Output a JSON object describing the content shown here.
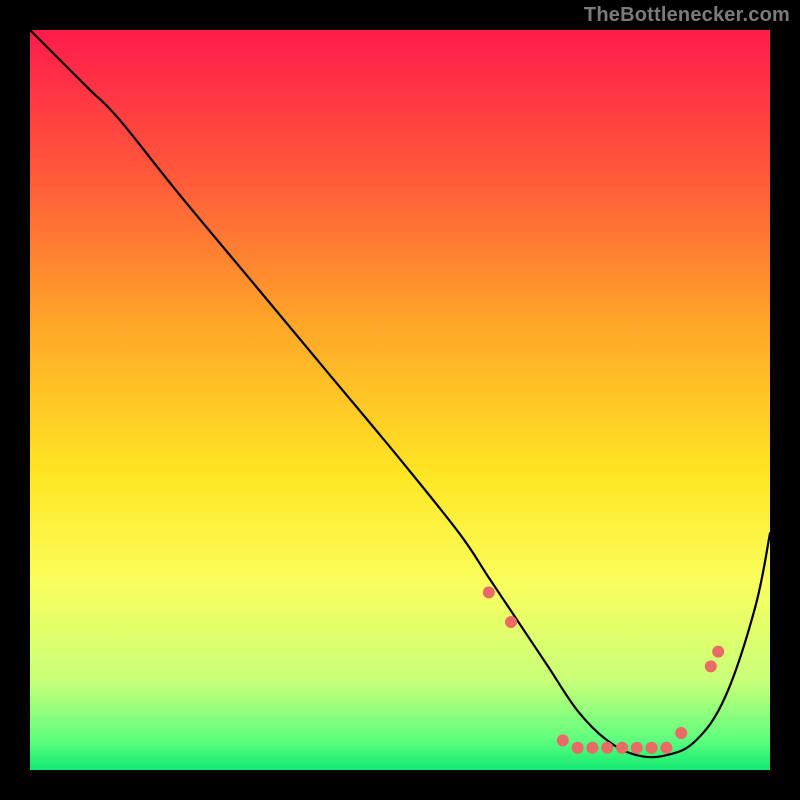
{
  "watermark": "TheBottlenecker.com",
  "chart_data": {
    "type": "line",
    "title": "",
    "xlabel": "",
    "ylabel": "",
    "xlim": [
      0,
      100
    ],
    "ylim": [
      0,
      100
    ],
    "grid": false,
    "background_gradient_stops": [
      {
        "offset": 0,
        "color": "#ff1b4b"
      },
      {
        "offset": 20,
        "color": "#ff5a3a"
      },
      {
        "offset": 40,
        "color": "#ffa728"
      },
      {
        "offset": 60,
        "color": "#ffe624"
      },
      {
        "offset": 75,
        "color": "#f9ff5e"
      },
      {
        "offset": 88,
        "color": "#c8ff7a"
      },
      {
        "offset": 96,
        "color": "#5dff7e"
      },
      {
        "offset": 100,
        "color": "#10e870"
      }
    ],
    "series": [
      {
        "name": "bottleneck-curve",
        "color": "#000000",
        "stroke_width": 2.2,
        "x": [
          0,
          4,
          8,
          12,
          20,
          30,
          40,
          50,
          58,
          62,
          66,
          70,
          74,
          78,
          82,
          86,
          90,
          94,
          98,
          100
        ],
        "y": [
          100,
          96,
          92,
          88,
          78,
          66,
          54,
          42,
          32,
          26,
          20,
          14,
          8,
          4,
          2,
          2,
          4,
          10,
          22,
          32
        ]
      }
    ],
    "markers": {
      "name": "highlight-points",
      "color": "#ea6a66",
      "radius": 6,
      "x": [
        62,
        65,
        72,
        74,
        76,
        78,
        80,
        82,
        84,
        86,
        88,
        92,
        93
      ],
      "y": [
        24,
        20,
        4,
        3,
        3,
        3,
        3,
        3,
        3,
        3,
        5,
        14,
        16
      ]
    }
  }
}
